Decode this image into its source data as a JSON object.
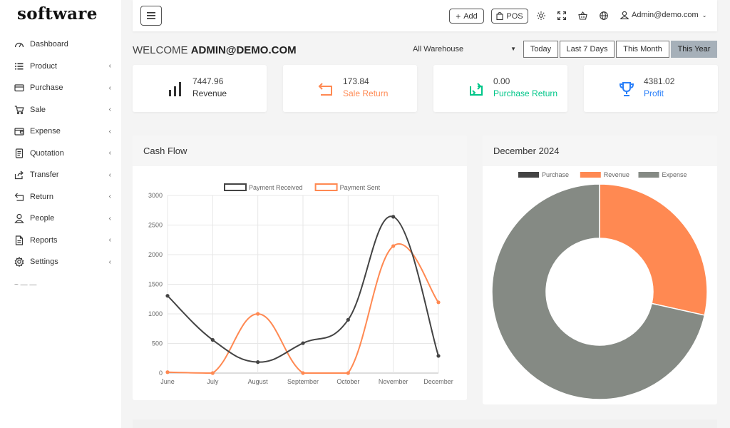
{
  "brand": {
    "logo": "software"
  },
  "sidebar": {
    "items": [
      {
        "label": "Dashboard",
        "icon": "gauge-icon",
        "has_chevron": false
      },
      {
        "label": "Product",
        "icon": "list-icon",
        "has_chevron": true
      },
      {
        "label": "Purchase",
        "icon": "card-icon",
        "has_chevron": true
      },
      {
        "label": "Sale",
        "icon": "cart-icon",
        "has_chevron": true
      },
      {
        "label": "Expense",
        "icon": "wallet-icon",
        "has_chevron": true
      },
      {
        "label": "Quotation",
        "icon": "document-icon",
        "has_chevron": true
      },
      {
        "label": "Transfer",
        "icon": "share-icon",
        "has_chevron": true
      },
      {
        "label": "Return",
        "icon": "return-icon",
        "has_chevron": true
      },
      {
        "label": "People",
        "icon": "user-icon",
        "has_chevron": true
      },
      {
        "label": "Reports",
        "icon": "file-icon",
        "has_chevron": true
      },
      {
        "label": "Settings",
        "icon": "gear-icon",
        "has_chevron": true
      }
    ],
    "chevron": "‹"
  },
  "topbar": {
    "add_label": "Add",
    "pos_label": "POS",
    "user_label": "Admin@demo.com"
  },
  "welcome": {
    "prefix": "WELCOME",
    "user": "ADMIN@DEMO.COM"
  },
  "warehouse": {
    "selected": "All Warehouse"
  },
  "periods": {
    "today": "Today",
    "last7": "Last 7 Days",
    "month": "This Month",
    "year": "This Year",
    "active": "This Year"
  },
  "stats": {
    "revenue": {
      "value": "7447.96",
      "label": "Revenue",
      "color": "#333333"
    },
    "sale_return": {
      "value": "173.84",
      "label": "Sale Return",
      "color": "#ff8952"
    },
    "purchase_return": {
      "value": "0.00",
      "label": "Purchase Return",
      "color": "#00c689"
    },
    "profit": {
      "value": "4381.02",
      "label": "Profit",
      "color": "#297ff9"
    }
  },
  "cashflow": {
    "title": "Cash Flow"
  },
  "donut": {
    "title": "December 2024"
  },
  "chart_data": [
    {
      "type": "line",
      "x": [
        "June",
        "July",
        "August",
        "September",
        "October",
        "November",
        "December"
      ],
      "series": [
        {
          "name": "Payment Received",
          "color": "#444444",
          "values": [
            1305,
            560,
            185,
            505,
            900,
            2640,
            290
          ]
        },
        {
          "name": "Payment Sent",
          "color": "#ff8952",
          "values": [
            15,
            0,
            1000,
            0,
            0,
            2145,
            1195
          ]
        }
      ],
      "ylim": [
        0,
        3000
      ],
      "yticks": [
        0,
        500,
        1000,
        1500,
        2000,
        2500,
        3000
      ],
      "grid": true,
      "legend": "top"
    },
    {
      "type": "pie",
      "categories": [
        "Purchase",
        "Revenue",
        "Expense"
      ],
      "colors": [
        "#444444",
        "#ff8952",
        "#858a84"
      ],
      "values": [
        0,
        28.5,
        71.5
      ],
      "legend": "top"
    }
  ]
}
